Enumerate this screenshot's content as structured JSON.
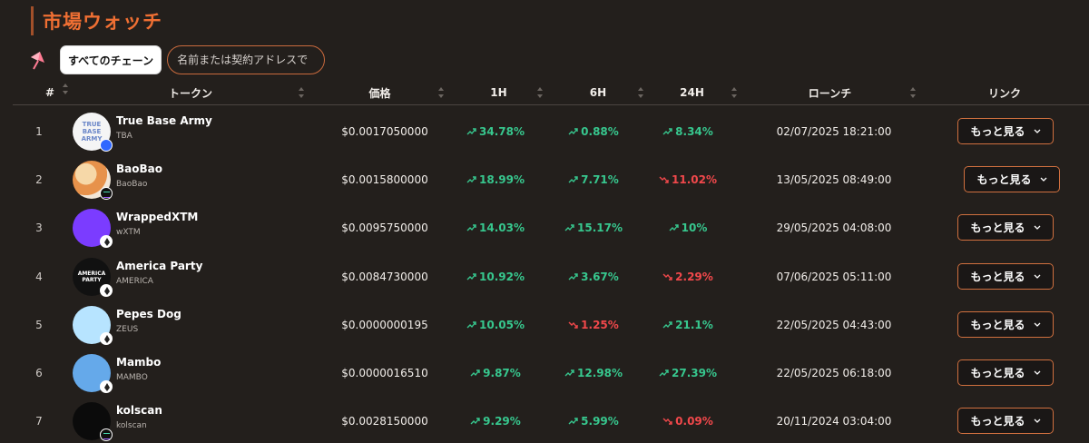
{
  "page": {
    "title": "市場ウォッチ"
  },
  "filters": {
    "chain_button": "すべてのチェーン",
    "search_placeholder": "名前または契約アドレスで"
  },
  "columns": [
    "#",
    "トークン",
    "価格",
    "1H",
    "6H",
    "24H",
    "ローンチ",
    "リンク"
  ],
  "link_label": "もっと見る",
  "rows": [
    {
      "index": "1",
      "name": "True Base Army",
      "symbol": "TBA",
      "avatar_text": "TRUE BASE ARMY",
      "price": "$0.0017050000",
      "h1": "34.78%",
      "h6": "0.88%",
      "h24": "8.34%",
      "launch": "02/07/2025 18:21:00",
      "h1_trend": "up",
      "h6_trend": "up",
      "h24_trend": "up",
      "chain": "base"
    },
    {
      "index": "2",
      "name": "BaoBao",
      "symbol": "BaoBao",
      "avatar_text": "",
      "price": "$0.0015800000",
      "h1": "18.99%",
      "h6": "7.71%",
      "h24": "11.02%",
      "launch": "13/05/2025 08:49:00",
      "h1_trend": "up",
      "h6_trend": "up",
      "h24_trend": "down",
      "chain": "sol"
    },
    {
      "index": "3",
      "name": "WrappedXTM",
      "symbol": "wXTM",
      "avatar_text": "",
      "price": "$0.0095750000",
      "h1": "14.03%",
      "h6": "15.17%",
      "h24": "10%",
      "launch": "29/05/2025 04:08:00",
      "h1_trend": "up",
      "h6_trend": "up",
      "h24_trend": "up",
      "chain": "eth"
    },
    {
      "index": "4",
      "name": "America Party",
      "symbol": "AMERICA",
      "avatar_text": "AMERICA PARTY",
      "price": "$0.0084730000",
      "h1": "10.92%",
      "h6": "3.67%",
      "h24": "2.29%",
      "launch": "07/06/2025 05:11:00",
      "h1_trend": "up",
      "h6_trend": "up",
      "h24_trend": "down",
      "chain": "eth"
    },
    {
      "index": "5",
      "name": "Pepes Dog",
      "symbol": "ZEUS",
      "avatar_text": "",
      "price": "$0.0000000195",
      "h1": "10.05%",
      "h6": "1.25%",
      "h24": "21.1%",
      "launch": "22/05/2025 04:43:00",
      "h1_trend": "up",
      "h6_trend": "down",
      "h24_trend": "up",
      "chain": "eth"
    },
    {
      "index": "6",
      "name": "Mambo",
      "symbol": "MAMBO",
      "avatar_text": "",
      "price": "$0.0000016510",
      "h1": "9.87%",
      "h6": "12.98%",
      "h24": "27.39%",
      "launch": "22/05/2025 06:18:00",
      "h1_trend": "up",
      "h6_trend": "up",
      "h24_trend": "up",
      "chain": "eth"
    },
    {
      "index": "7",
      "name": "kolscan",
      "symbol": "kolscan",
      "avatar_text": "",
      "price": "$0.0028150000",
      "h1": "9.29%",
      "h6": "5.99%",
      "h24": "0.09%",
      "launch": "20/11/2024 03:04:00",
      "h1_trend": "up",
      "h6_trend": "up",
      "h24_trend": "down",
      "chain": "sol"
    }
  ],
  "colors": {
    "background": "#231f1c",
    "accent": "#ef6f33",
    "up": "#37c78e",
    "down": "#f1484b",
    "button_border": "#d0703f"
  },
  "icons": {
    "filter": "umbrella-icon",
    "sort": "sort-arrows-icon",
    "up": "trending-up-icon",
    "down": "trending-down-icon",
    "dropdown": "chevron-down-icon"
  }
}
